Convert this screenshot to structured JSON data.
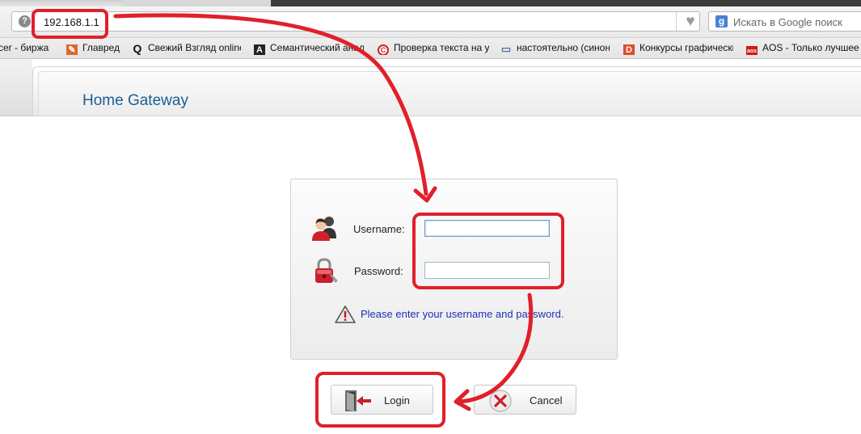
{
  "browser": {
    "url": "192.168.1.1",
    "search_placeholder": "Искать в Google поиск",
    "bookmarks": [
      {
        "label": "cer - биржа",
        "icon": "none"
      },
      {
        "label": "Главред",
        "icon": "glavred-icon"
      },
      {
        "label": "Свежий Взгляд online",
        "icon": "q-icon"
      },
      {
        "label": "Семантический анализ",
        "icon": "a-icon"
      },
      {
        "label": "Проверка текста на у",
        "icon": "copyright-icon"
      },
      {
        "label": "настоятельно (синон",
        "icon": "book-icon"
      },
      {
        "label": "Конкурсы графически",
        "icon": "d-icon"
      },
      {
        "label": "AOS - Только лучшее",
        "icon": "aos-icon"
      }
    ]
  },
  "page": {
    "title": "Home Gateway"
  },
  "login": {
    "username_label": "Username:",
    "password_label": "Password:",
    "username_value": "",
    "password_value": "",
    "message": "Please enter your username and password.",
    "login_button": "Login",
    "cancel_button": "Cancel"
  },
  "colors": {
    "title": "#1b5e94",
    "message": "#1d2fb8",
    "annotation": "#e0202a"
  }
}
